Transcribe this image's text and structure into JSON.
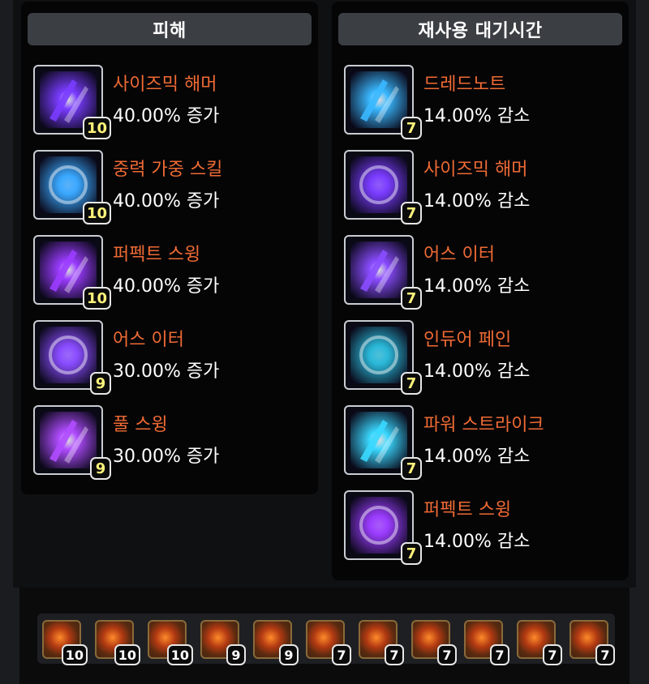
{
  "damage_panel": {
    "title": "피해",
    "entries": [
      {
        "name": "사이즈믹 해머",
        "value": "40.00% 증가",
        "level": "10",
        "icon": "seismic-hammer-icon",
        "color": "#7a3cff"
      },
      {
        "name": "중력 가중 스킬",
        "value": "40.00% 증가",
        "level": "10",
        "icon": "gravity-skill-icon",
        "color": "#3aa8ff"
      },
      {
        "name": "퍼펙트 스윙",
        "value": "40.00% 증가",
        "level": "10",
        "icon": "perfect-swing-icon",
        "color": "#9b3cff"
      },
      {
        "name": "어스 이터",
        "value": "30.00% 증가",
        "level": "9",
        "icon": "earth-eater-icon",
        "color": "#8a4cff"
      },
      {
        "name": "풀 스윙",
        "value": "30.00% 증가",
        "level": "9",
        "icon": "full-swing-icon",
        "color": "#b04cff"
      }
    ]
  },
  "cooldown_panel": {
    "title": "재사용 대기시간",
    "entries": [
      {
        "name": "드레드노트",
        "value": "14.00% 감소",
        "level": "7",
        "icon": "dreadnought-icon",
        "color": "#3ab8ff"
      },
      {
        "name": "사이즈믹 해머",
        "value": "14.00% 감소",
        "level": "7",
        "icon": "seismic-hammer-icon",
        "color": "#7a3cff"
      },
      {
        "name": "어스 이터",
        "value": "14.00% 감소",
        "level": "7",
        "icon": "earth-eater-icon",
        "color": "#8a4cff"
      },
      {
        "name": "인듀어 페인",
        "value": "14.00% 감소",
        "level": "7",
        "icon": "endure-pain-icon",
        "color": "#2ab8d8"
      },
      {
        "name": "파워 스트라이크",
        "value": "14.00% 감소",
        "level": "7",
        "icon": "power-strike-icon",
        "color": "#3ad8ff"
      },
      {
        "name": "퍼펙트 스윙",
        "value": "14.00% 감소",
        "level": "7",
        "icon": "perfect-swing-icon",
        "color": "#9b3cff"
      }
    ]
  },
  "gems": [
    {
      "level": "10",
      "icon": "gem-damage-icon"
    },
    {
      "level": "10",
      "icon": "gem-damage-icon"
    },
    {
      "level": "10",
      "icon": "gem-damage-icon"
    },
    {
      "level": "9",
      "icon": "gem-damage-icon"
    },
    {
      "level": "9",
      "icon": "gem-damage-icon"
    },
    {
      "level": "7",
      "icon": "gem-cooldown-icon"
    },
    {
      "level": "7",
      "icon": "gem-cooldown-icon"
    },
    {
      "level": "7",
      "icon": "gem-cooldown-icon"
    },
    {
      "level": "7",
      "icon": "gem-cooldown-icon"
    },
    {
      "level": "7",
      "icon": "gem-cooldown-icon"
    },
    {
      "level": "7",
      "icon": "gem-cooldown-icon"
    }
  ],
  "colors": {
    "skill_name": "#ef6a34",
    "damage_level": "#fff37a",
    "header_bg": "#3b3e43"
  }
}
